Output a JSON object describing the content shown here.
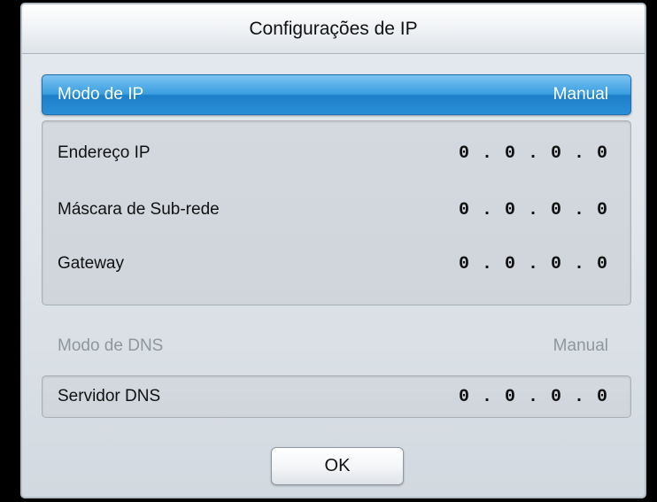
{
  "dialog": {
    "title": "Configurações de IP"
  },
  "ip_mode": {
    "label": "Modo de IP",
    "value": "Manual"
  },
  "ip_fields": [
    {
      "label": "Endereço IP",
      "value": "0 . 0 . 0 . 0"
    },
    {
      "label": "Máscara de Sub-rede",
      "value": "0 . 0 . 0 . 0"
    },
    {
      "label": "Gateway",
      "value": "0 . 0 . 0 . 0"
    }
  ],
  "dns_mode": {
    "label": "Modo de DNS",
    "value": "Manual"
  },
  "dns_server": {
    "label": "Servidor DNS",
    "value": "0 . 0 . 0 . 0"
  },
  "buttons": {
    "ok_label": "OK"
  },
  "colors": {
    "highlight": "#2a8fd6",
    "dialog_bg": "#dfe5ea",
    "disabled_text": "#8e969e"
  }
}
